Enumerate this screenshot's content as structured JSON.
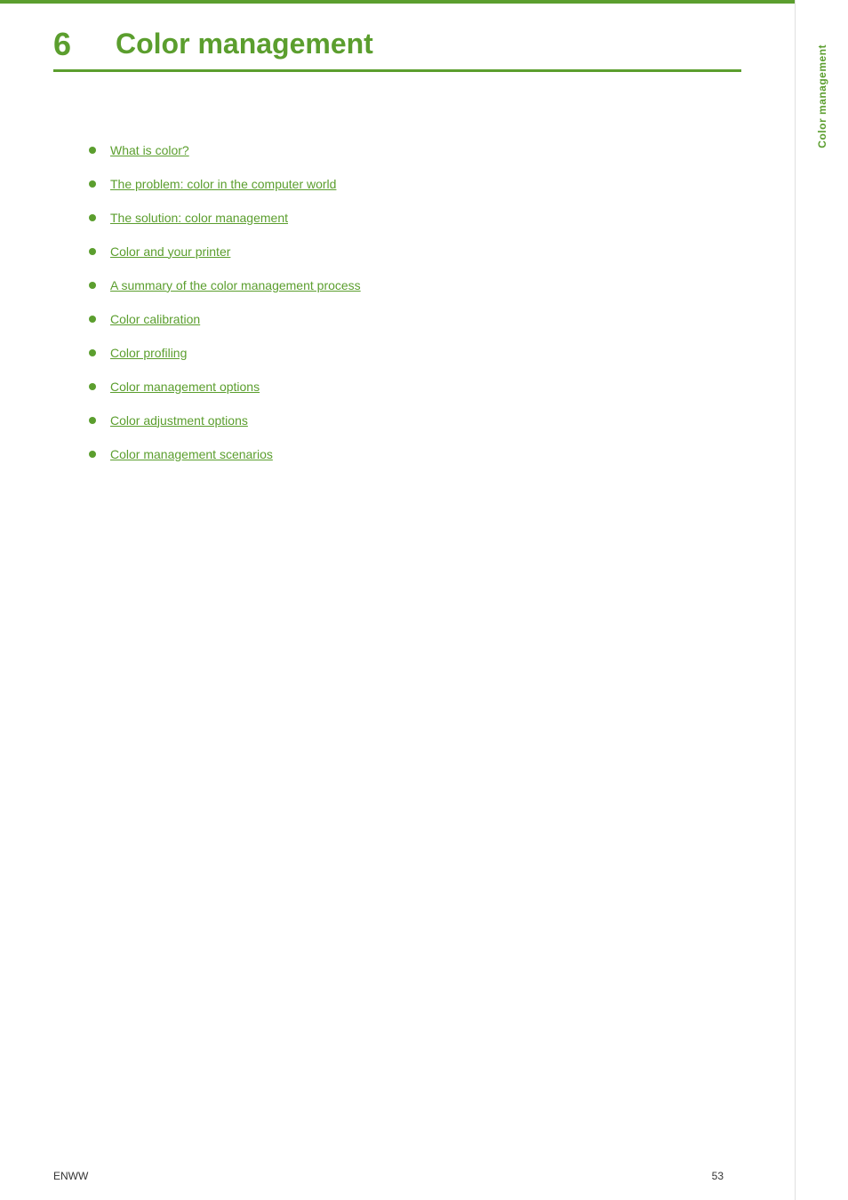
{
  "page": {
    "background": "#ffffff",
    "accent_color": "#5b9e2e"
  },
  "header": {
    "chapter_number": "6",
    "chapter_title": "Color management"
  },
  "side_tab": {
    "label": "Color management"
  },
  "toc": {
    "items": [
      {
        "label": "What is color?",
        "href": "#"
      },
      {
        "label": "The problem: color in the computer world",
        "href": "#"
      },
      {
        "label": "The solution: color management",
        "href": "#"
      },
      {
        "label": "Color and your printer",
        "href": "#"
      },
      {
        "label": "A summary of the color management process",
        "href": "#"
      },
      {
        "label": "Color calibration",
        "href": "#"
      },
      {
        "label": "Color profiling",
        "href": "#"
      },
      {
        "label": "Color management options",
        "href": "#"
      },
      {
        "label": "Color adjustment options",
        "href": "#"
      },
      {
        "label": "Color management scenarios",
        "href": "#"
      }
    ]
  },
  "footer": {
    "left_label": "ENWW",
    "page_number": "53"
  }
}
